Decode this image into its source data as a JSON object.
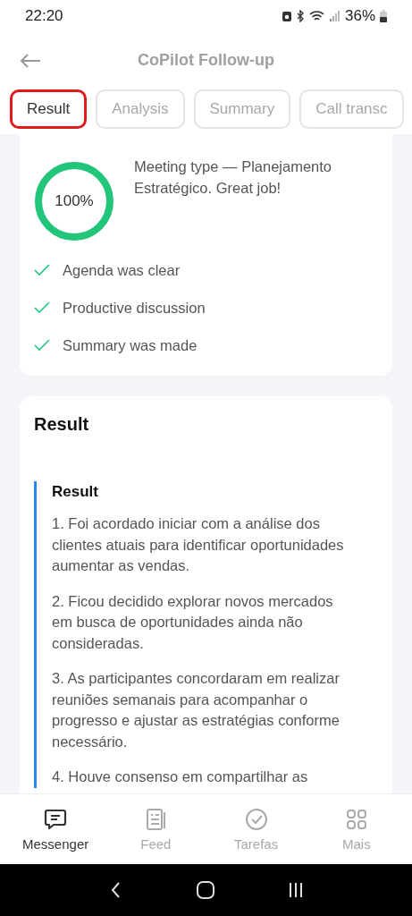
{
  "status_bar": {
    "time": "22:20",
    "battery": "36%"
  },
  "header": {
    "title": "CoPilot Follow-up"
  },
  "tabs": [
    {
      "label": "Result",
      "selected": true
    },
    {
      "label": "Analysis",
      "selected": false
    },
    {
      "label": "Summary",
      "selected": false
    },
    {
      "label": "Call transc",
      "selected": false
    }
  ],
  "score_card": {
    "score": "100%",
    "level": 1,
    "message": "Meeting type — Planejamento Estratégico. Great job!",
    "criteria": [
      {
        "label": "Agenda was clear",
        "checked": true
      },
      {
        "label": "Productive discussion",
        "checked": true
      },
      {
        "label": "Summary was made",
        "checked": true
      }
    ]
  },
  "result_card": {
    "title": "Result",
    "section_title": "Result",
    "paragraphs": [
      {
        "lines": [
          "1. Foi acordado iniciar com a análise dos",
          "clientes atuais para identificar oportunidades",
          "aumentar as vendas."
        ]
      },
      {
        "lines": [
          "2. Ficou decidido explorar novos mercados",
          "em busca de oportunidades ainda não",
          "consideradas."
        ]
      },
      {
        "lines": [
          "3. As participantes concordaram em realizar",
          "reuniões semanais para acompanhar o",
          "progresso e ajustar as estratégias conforme",
          "necessário."
        ]
      },
      {
        "lines": [
          "4. Houve consenso em compartilhar as"
        ]
      }
    ]
  },
  "bottom_nav": [
    {
      "label": "Messenger",
      "selected": true
    },
    {
      "label": "Feed",
      "selected": false
    },
    {
      "label": "Tarefas",
      "selected": false
    },
    {
      "label": "Mais",
      "selected": false
    }
  ]
}
